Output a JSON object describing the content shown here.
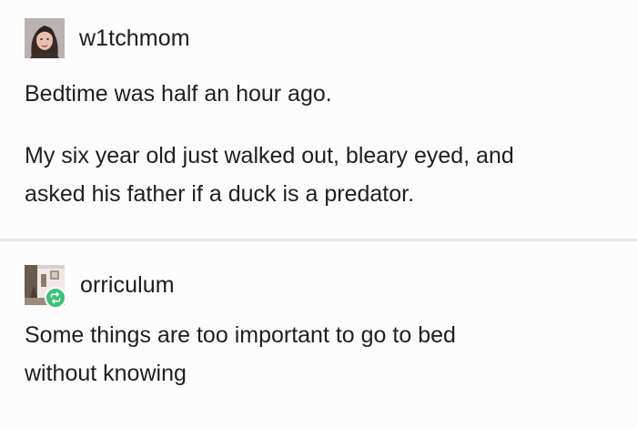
{
  "posts": [
    {
      "username": "w1tchmom",
      "paragraphs": [
        [
          "Bedtime was half an hour ago."
        ],
        [
          "My six year old just walked out, bleary eyed, and",
          "asked his father if a duck is a predator."
        ]
      ]
    },
    {
      "username": "orriculum",
      "reblog_icon": "reblog-icon",
      "reblog_color": "#3ec07c",
      "paragraphs": [
        [
          "Some things are too important to go to bed",
          "without knowing"
        ]
      ]
    }
  ]
}
